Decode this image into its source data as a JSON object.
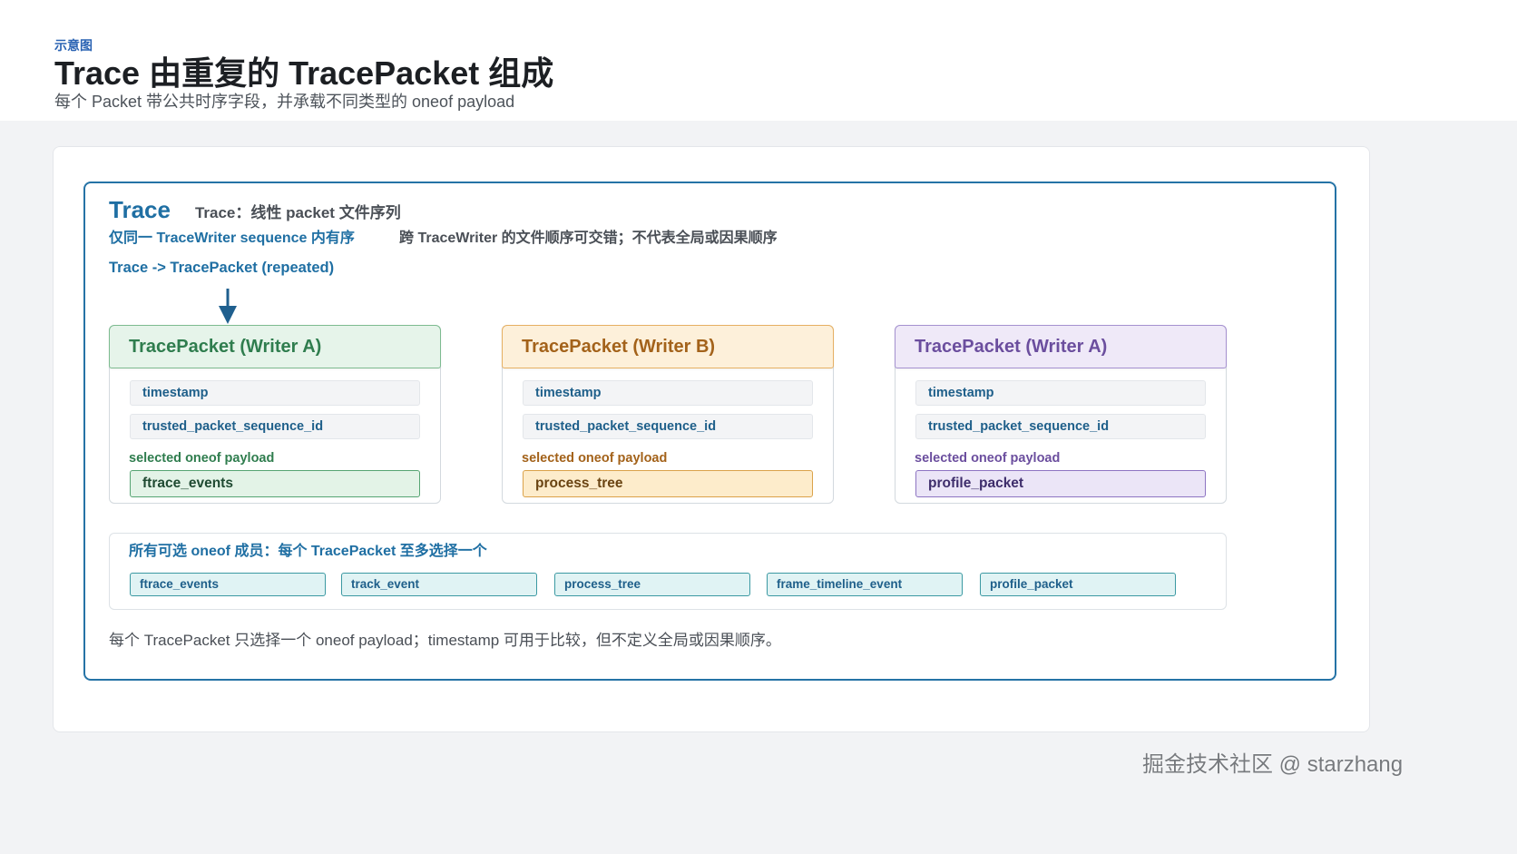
{
  "header": {
    "eyebrow": "示意图",
    "title": "Trace 由重复的 TracePacket 组成",
    "subtitle": "每个 Packet 带公共时序字段，并承载不同类型的 oneof payload"
  },
  "trace": {
    "label": "Trace",
    "description": "Trace：线性 packet 文件序列",
    "order_note": "仅同一 TraceWriter sequence 内有序",
    "interleave_note": "跨 TraceWriter 的文件顺序可交错；不代表全局或因果顺序",
    "relation": "Trace -> TracePacket (repeated)",
    "relation_icon": "arrow-down-icon"
  },
  "packets": [
    {
      "title": "TracePacket (Writer A)",
      "fields": [
        "timestamp",
        "trusted_packet_sequence_id"
      ],
      "payload_label": "selected oneof payload",
      "payload": "ftrace_events"
    },
    {
      "title": "TracePacket (Writer B)",
      "fields": [
        "timestamp",
        "trusted_packet_sequence_id"
      ],
      "payload_label": "selected oneof payload",
      "payload": "process_tree"
    },
    {
      "title": "TracePacket (Writer A)",
      "fields": [
        "timestamp",
        "trusted_packet_sequence_id"
      ],
      "payload_label": "selected oneof payload",
      "payload": "profile_packet"
    }
  ],
  "members": {
    "title": "所有可选 oneof 成员：每个 TracePacket 至多选择一个",
    "items": [
      "ftrace_events",
      "track_event",
      "process_tree",
      "frame_timeline_event",
      "profile_packet"
    ]
  },
  "footer_note": "每个 TracePacket 只选择一个 oneof payload；timestamp 可用于比较，但不定义全局或因果顺序。",
  "watermark": "掘金技术社区 @ starzhang",
  "colors": {
    "eyebrow_blue": "#2a63b3",
    "brand_blue": "#1f6fa3",
    "trace_border": "#2573a6",
    "arrow_blue": "#1f5f8e",
    "field_text": "#1e5f8a",
    "green_accent": "#2f7d4e",
    "green_tint": "#e6f4ea",
    "green_border": "#7dbb90",
    "green_strong": "#56a473",
    "amber_accent": "#a3621a",
    "amber_tint": "#fdf0da",
    "amber_border": "#e6b063",
    "amber_strong": "#dba24a",
    "purple_accent": "#6b4e9e",
    "purple_tint": "#efe9f8",
    "purple_border": "#a591d0",
    "purple_strong": "#8d74c2",
    "chip_tint": "#e0f3f4",
    "chip_border": "#3b99a2"
  }
}
